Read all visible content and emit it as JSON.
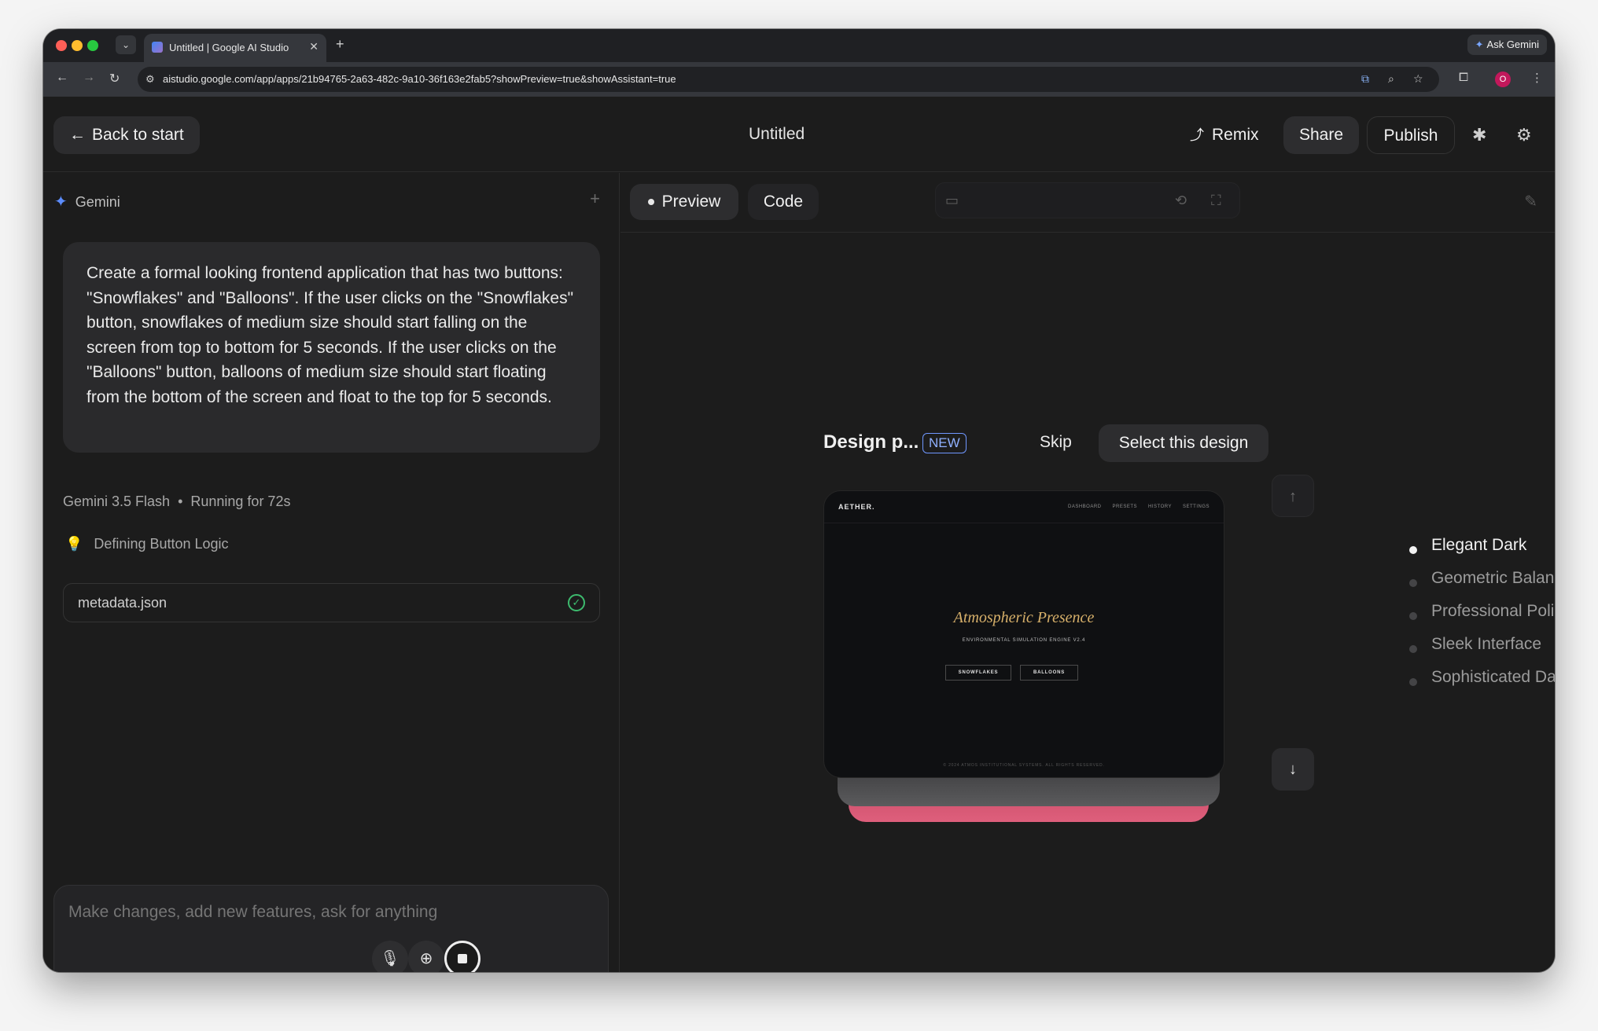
{
  "browser": {
    "tab_title": "Untitled | Google AI Studio",
    "tab_close": "✕",
    "new_tab": "+",
    "ask_gemini": "Ask Gemini",
    "url": "aistudio.google.com/app/apps/21b94765-2a63-482c-9a10-36f163e2fab5?showPreview=true&showAssistant=true",
    "profile_initial": "O"
  },
  "header": {
    "back_label": "Back to start",
    "title": "Untitled",
    "remix_label": "Remix",
    "share_label": "Share",
    "publish_label": "Publish"
  },
  "chat": {
    "assistant_name": "Gemini",
    "prompt": "Create a formal looking frontend application that has two buttons: \"Snowflakes\" and \"Balloons\". If the user clicks on the \"Snowflakes\" button, snowflakes of medium size should start falling on the screen from top to bottom for 5 seconds. If the user clicks on the \"Balloons\" button, balloons of medium size should start floating from the bottom of the screen and float to the top for 5 seconds.",
    "model": "Gemini 3.5 Flash",
    "run_status": "Running for 72s",
    "thinking_label": "Defining Button Logic",
    "file_name": "metadata.json",
    "composer_placeholder": "Make changes, add new features, ask for anything"
  },
  "workspace": {
    "tabs": [
      {
        "label": "Preview",
        "active": true
      },
      {
        "label": "Code",
        "active": false
      }
    ]
  },
  "design_picker": {
    "label": "Design p...",
    "badge": "NEW",
    "skip_label": "Skip",
    "select_label": "Select this design",
    "options": [
      {
        "label": "Elegant Dark",
        "active": true
      },
      {
        "label": "Geometric Balance",
        "active": false
      },
      {
        "label": "Professional Polish",
        "active": false
      },
      {
        "label": "Sleek Interface",
        "active": false
      },
      {
        "label": "Sophisticated Dark",
        "active": false
      }
    ],
    "preview": {
      "brand": "AETHER.",
      "nav": [
        "DASHBOARD",
        "PRESETS",
        "HISTORY",
        "SETTINGS"
      ],
      "title": "Atmospheric Presence",
      "subtitle": "ENVIRONMENTAL SIMULATION ENGINE V2.4",
      "button_1": "SNOWFLAKES",
      "button_2": "BALLOONS",
      "footer": "© 2024 ATMOS INSTITUTIONAL SYSTEMS. ALL RIGHTS RESERVED."
    }
  },
  "colors": {
    "accent_blue": "#5c8dff",
    "preview_title_gold": "#d7b06a",
    "success_green": "#3dbb6e",
    "stack_pink": "#de5f7c"
  }
}
